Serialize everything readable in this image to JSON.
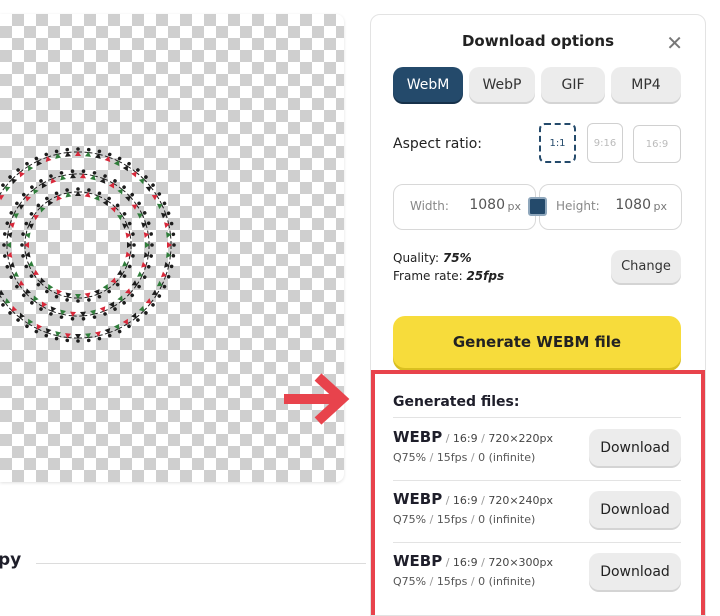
{
  "panel": {
    "title": "Download options",
    "formats": [
      "WebM",
      "WebP",
      "GIF",
      "MP4"
    ],
    "aspect_label": "Aspect ratio:",
    "ratios": [
      "1:1",
      "9:16",
      "16:9"
    ],
    "width_label": "Width:",
    "width_value": "1080",
    "height_label": "Height:",
    "height_value": "1080",
    "unit": "px",
    "quality_label": "Quality:",
    "quality_value": "75%",
    "framerate_label": "Frame rate:",
    "framerate_value": "25fps",
    "change_label": "Change",
    "generate_label": "Generate WEBM file",
    "generated_title": "Generated files:",
    "download_label": "Download",
    "files": [
      {
        "format": "WEBP",
        "ratio": "16:9",
        "size": "720×220px",
        "quality": "Q75%",
        "fps": "15fps",
        "loop": "0 (infinite)"
      },
      {
        "format": "WEBP",
        "ratio": "16:9",
        "size": "720×240px",
        "quality": "Q75%",
        "fps": "15fps",
        "loop": "0 (infinite)"
      },
      {
        "format": "WEBP",
        "ratio": "16:9",
        "size": "720×300px",
        "quality": "Q75%",
        "fps": "15fps",
        "loop": "0 (infinite)"
      }
    ]
  },
  "bottom_text": "py",
  "colors": {
    "accent": "#244a6b",
    "generate": "#f7dc3b",
    "highlight": "#e8434c"
  }
}
